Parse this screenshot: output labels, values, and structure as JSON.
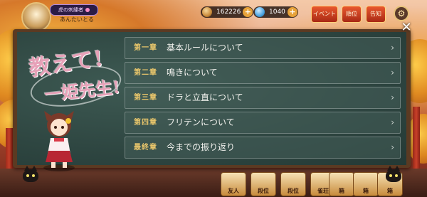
{
  "hud": {
    "player_title": "虎の刺繍者",
    "player_name": "あんたいとる",
    "currencies": [
      {
        "icon": "coin-icon",
        "value": "162226",
        "color": "#c98a3a"
      },
      {
        "icon": "jade-icon",
        "value": "1040",
        "color": "#4aa3e0"
      }
    ],
    "buttons": {
      "event": "イベント",
      "ranking": "順位",
      "notice": "告知"
    }
  },
  "dialog": {
    "logo_line1": "教えて!",
    "logo_line2": "一姫先生!",
    "chapters": [
      {
        "number": "第一章",
        "title": "基本ルールについて"
      },
      {
        "number": "第二章",
        "title": "鳴きについて"
      },
      {
        "number": "第三章",
        "title": "ドラと立直について"
      },
      {
        "number": "第四章",
        "title": "フリテンについて"
      },
      {
        "number": "最終章",
        "title": "今までの振り返り"
      }
    ]
  },
  "bottom_bar": {
    "items": [
      "友人",
      "段位",
      "段位",
      "雀荘",
      "箱",
      "箱",
      "箱"
    ]
  },
  "colors": {
    "board": "#2f4742",
    "chapter_number": "#e9c66b",
    "logo_pink": "#e7a1b8"
  }
}
